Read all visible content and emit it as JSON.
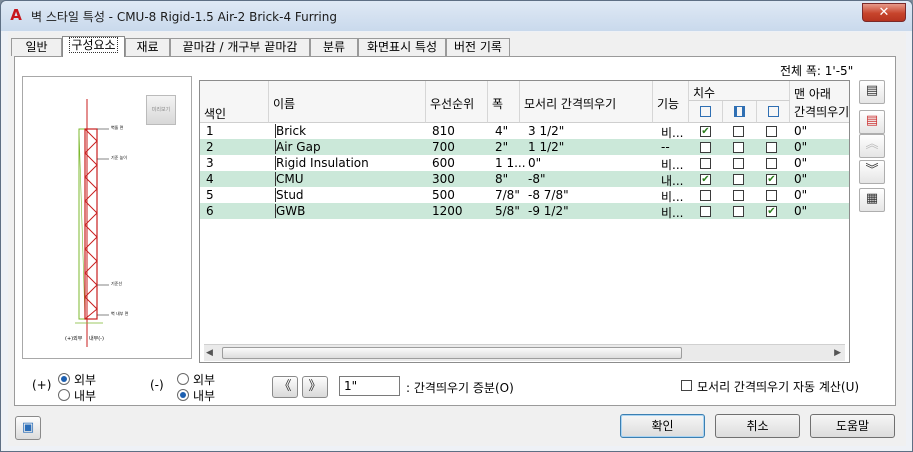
{
  "window": {
    "title": "벽 스타일 특성 - CMU-8 Rigid-1.5 Air-2 Brick-4 Furring",
    "app_icon": "A",
    "close_label": "✕"
  },
  "tabs": [
    {
      "label": "일반",
      "active": false
    },
    {
      "label": "구성요소",
      "active": true
    },
    {
      "label": "재료",
      "active": false
    },
    {
      "label": "끝마감 / 개구부 끝마감",
      "active": false
    },
    {
      "label": "분류",
      "active": false
    },
    {
      "label": "화면표시 특성",
      "active": false
    },
    {
      "label": "버전 기록",
      "active": false
    }
  ],
  "total_width": "전체 폭: 1'-5\"",
  "preview": {
    "thumb_label": "미리보기",
    "layer_labels": [
      "벽돌 면",
      "기준 높이",
      "기준선",
      "벽 내부 면"
    ],
    "sign_labels": [
      "(+)외부",
      "내부(-)"
    ]
  },
  "table": {
    "headers": {
      "index": "색인",
      "name": "이름",
      "priority": "우선순위",
      "width": "폭",
      "edge_offset": "모서리 간격띄우기",
      "function": "기능",
      "dims": "치수",
      "bottom": "맨 아래 ",
      "bottom2": "간격띄우기"
    },
    "rows": [
      {
        "index": "1",
        "name": "Brick",
        "priority": "810",
        "width": "4\"",
        "offset": "3 1/2\"",
        "function": "비...",
        "c1": true,
        "c2": false,
        "c3": false,
        "bottom": "0\""
      },
      {
        "index": "2",
        "name": "Air Gap",
        "priority": "700",
        "width": "2\"",
        "offset": "1 1/2\"",
        "function": "--",
        "c1": false,
        "c2": false,
        "c3": false,
        "bottom": "0\""
      },
      {
        "index": "3",
        "name": "Rigid Insulation",
        "priority": "600",
        "width": "1 1...",
        "offset": "0\"",
        "function": "비...",
        "c1": false,
        "c2": false,
        "c3": false,
        "bottom": "0\""
      },
      {
        "index": "4",
        "name": "CMU",
        "priority": "300",
        "width": "8\"",
        "offset": "-8\"",
        "function": "내...",
        "c1": true,
        "c2": false,
        "c3": true,
        "bottom": "0\""
      },
      {
        "index": "5",
        "name": "Stud",
        "priority": "500",
        "width": "7/8\"",
        "offset": "-8 7/8\"",
        "function": "비...",
        "c1": false,
        "c2": false,
        "c3": false,
        "bottom": "0\""
      },
      {
        "index": "6",
        "name": "GWB",
        "priority": "1200",
        "width": "5/8\"",
        "offset": "-9 1/2\"",
        "function": "비...",
        "c1": false,
        "c2": false,
        "c3": true,
        "bottom": "0\""
      }
    ]
  },
  "side_buttons": [
    "add-component",
    "delete-component",
    "move-up",
    "move-down",
    "copy-properties"
  ],
  "options": {
    "plus_label": "(+)",
    "minus_label": "(-)",
    "outside": "외부",
    "inside": "내부",
    "plus_selected": "outside",
    "minus_selected": "inside",
    "prev_label": "《",
    "next_label": "》",
    "increment_value": "1\"",
    "increment_label": ": 간격띄우기 증분(O)",
    "auto_calc_label": "모서리 간격띄우기 자동 계산(U)",
    "auto_calc_checked": false
  },
  "buttons": {
    "ok": "확인",
    "cancel": "취소",
    "help": "도움말"
  }
}
